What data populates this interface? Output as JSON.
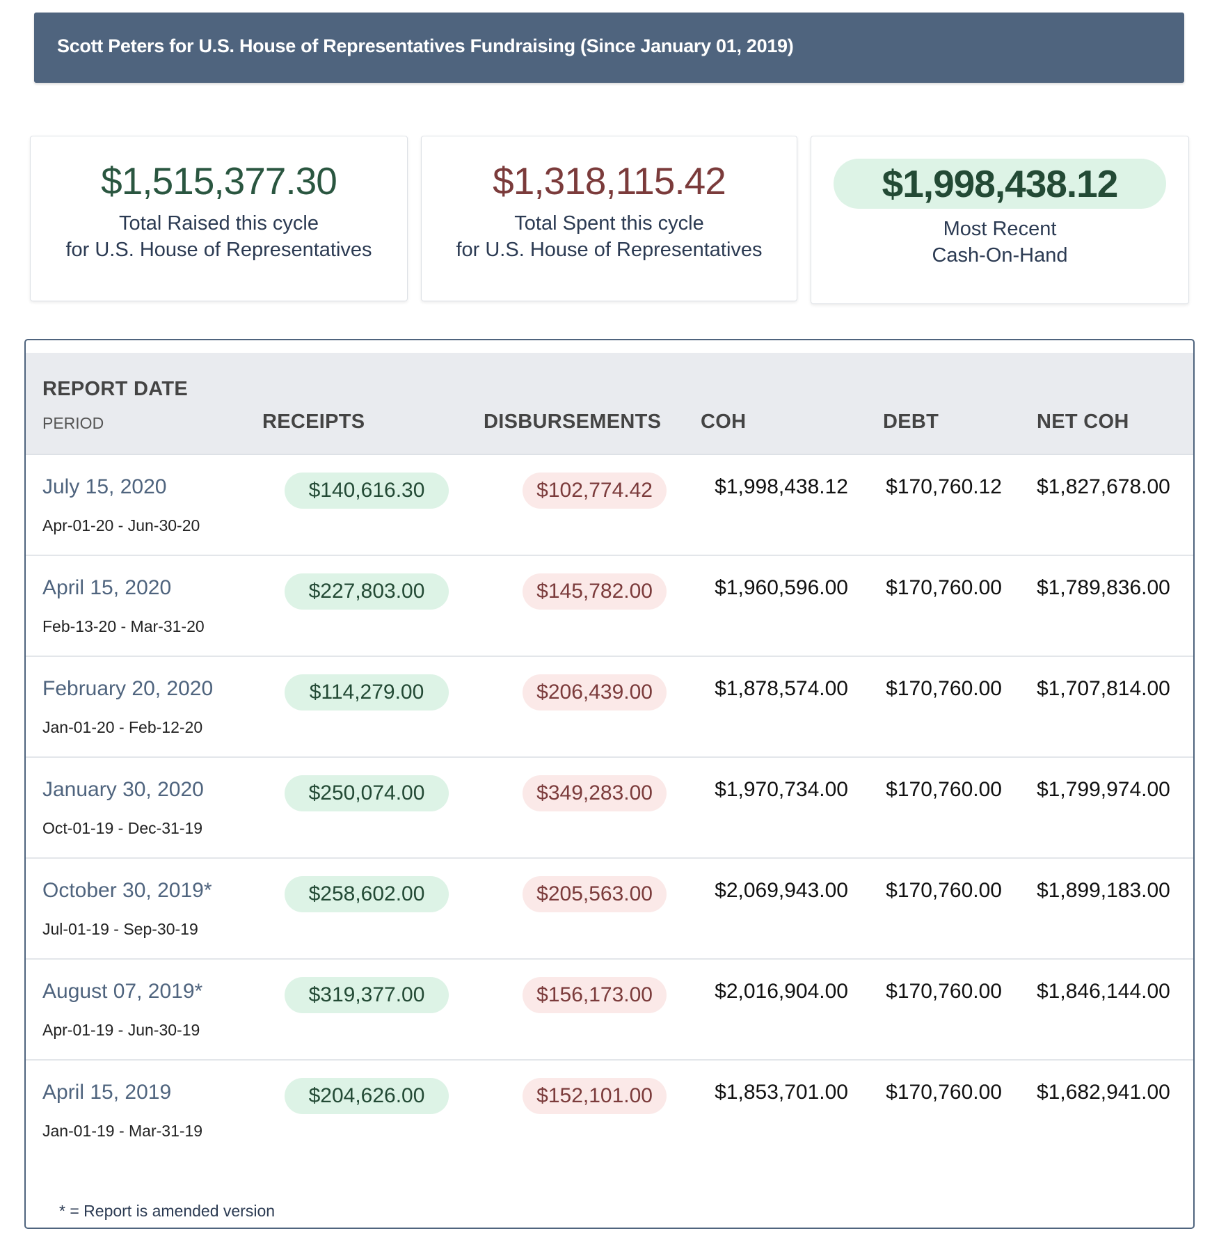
{
  "header": {
    "title": "Scott Peters for U.S. House of Representatives Fundraising (Since January 01, 2019)"
  },
  "cards": [
    {
      "value": "$1,515,377.30",
      "line1": "Total Raised this cycle",
      "line2": "for U.S. House of Representatives"
    },
    {
      "value": "$1,318,115.42",
      "line1": "Total Spent this cycle",
      "line2": "for U.S. House of Representatives"
    },
    {
      "value": "$1,998,438.12",
      "line1": "Most Recent",
      "line2": "Cash-On-Hand"
    }
  ],
  "colors": {
    "header": "#4f647e",
    "raised": "#2a5640",
    "spent": "#7b3b3b",
    "green_pill": "#ddf3e6",
    "red_pill": "#fbe9e8"
  },
  "table": {
    "headers": {
      "report_date": "REPORT DATE",
      "period": "PERIOD",
      "receipts": "RECEIPTS",
      "disbursements": "DISBURSEMENTS",
      "coh": "COH",
      "debt": "DEBT",
      "net_coh": "NET COH"
    },
    "rows": [
      {
        "date": "July 15, 2020",
        "period": "Apr-01-20 - Jun-30-20",
        "receipts": "$140,616.30",
        "disbursements": "$102,774.42",
        "coh": "$1,998,438.12",
        "debt": "$170,760.12",
        "net_coh": "$1,827,678.00"
      },
      {
        "date": "April 15, 2020",
        "period": "Feb-13-20 - Mar-31-20",
        "receipts": "$227,803.00",
        "disbursements": "$145,782.00",
        "coh": "$1,960,596.00",
        "debt": "$170,760.00",
        "net_coh": "$1,789,836.00"
      },
      {
        "date": "February 20, 2020",
        "period": "Jan-01-20 - Feb-12-20",
        "receipts": "$114,279.00",
        "disbursements": "$206,439.00",
        "coh": "$1,878,574.00",
        "debt": "$170,760.00",
        "net_coh": "$1,707,814.00"
      },
      {
        "date": "January 30, 2020",
        "period": "Oct-01-19 - Dec-31-19",
        "receipts": "$250,074.00",
        "disbursements": "$349,283.00",
        "coh": "$1,970,734.00",
        "debt": "$170,760.00",
        "net_coh": "$1,799,974.00"
      },
      {
        "date": "October 30, 2019*",
        "period": "Jul-01-19 - Sep-30-19",
        "receipts": "$258,602.00",
        "disbursements": "$205,563.00",
        "coh": "$2,069,943.00",
        "debt": "$170,760.00",
        "net_coh": "$1,899,183.00"
      },
      {
        "date": "August 07, 2019*",
        "period": "Apr-01-19 - Jun-30-19",
        "receipts": "$319,377.00",
        "disbursements": "$156,173.00",
        "coh": "$2,016,904.00",
        "debt": "$170,760.00",
        "net_coh": "$1,846,144.00"
      },
      {
        "date": "April 15, 2019",
        "period": "Jan-01-19 - Mar-31-19",
        "receipts": "$204,626.00",
        "disbursements": "$152,101.00",
        "coh": "$1,853,701.00",
        "debt": "$170,760.00",
        "net_coh": "$1,682,941.00"
      }
    ],
    "footnote": "* = Report is amended version"
  }
}
